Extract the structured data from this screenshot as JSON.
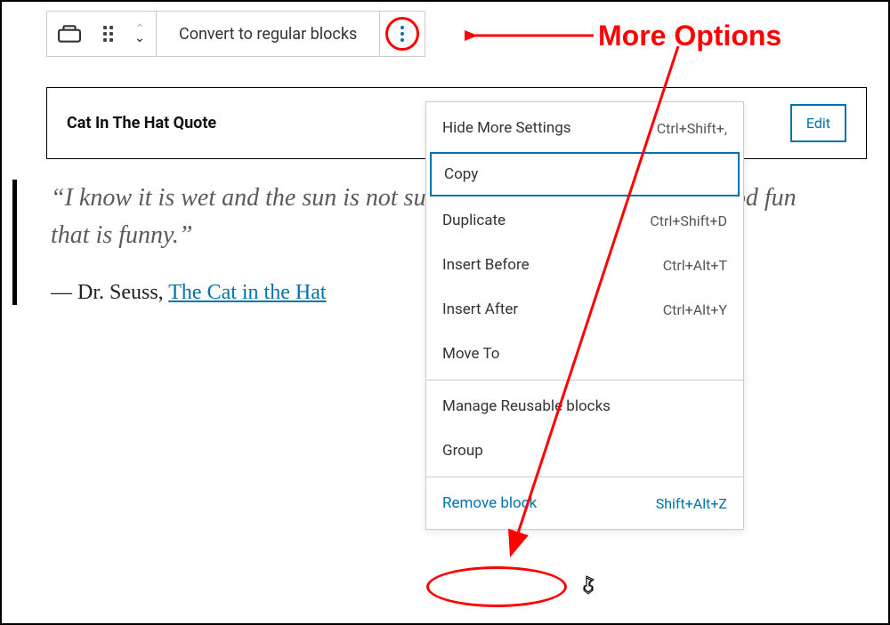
{
  "toolbar": {
    "convert_label": "Convert to regular blocks"
  },
  "block": {
    "title": "Cat In The Hat Quote",
    "edit_label": "Edit"
  },
  "quote": {
    "text": "“I know it is wet and the sun is not sunny, but we can have lots of good fun that is funny.”",
    "citation_prefix": "— Dr. Seuss, ",
    "link_text": "The Cat in the Hat"
  },
  "menu": {
    "section1": [
      {
        "label": "Hide More Settings",
        "shortcut": "Ctrl+Shift+,"
      },
      {
        "label": "Copy",
        "shortcut": "",
        "highlighted": true
      },
      {
        "label": "Duplicate",
        "shortcut": "Ctrl+Shift+D"
      },
      {
        "label": "Insert Before",
        "shortcut": "Ctrl+Alt+T"
      },
      {
        "label": "Insert After",
        "shortcut": "Ctrl+Alt+Y"
      },
      {
        "label": "Move To",
        "shortcut": ""
      }
    ],
    "section2": [
      {
        "label": "Manage Reusable blocks",
        "shortcut": ""
      },
      {
        "label": "Group",
        "shortcut": ""
      }
    ],
    "section3": [
      {
        "label": "Remove block",
        "shortcut": "Shift+Alt+Z",
        "remove": true
      }
    ]
  },
  "annotation": {
    "label": "More Options"
  }
}
